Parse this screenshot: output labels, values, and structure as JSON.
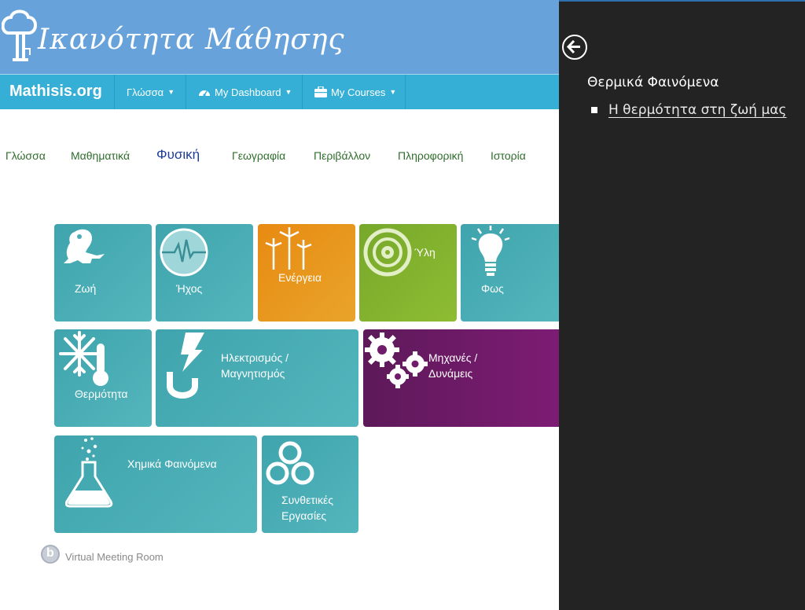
{
  "header": {
    "logo_text": "Ικανότητα Μάθησης"
  },
  "navbar": {
    "brand": "Mathisis.org",
    "language_menu": "Γλώσσα",
    "dashboard_menu": "My Dashboard",
    "courses_menu": "My Courses"
  },
  "subjects": {
    "items": [
      "Γλώσσα",
      "Μαθηματικά",
      "Φυσική",
      "Γεωγραφία",
      "Περιβάλλον",
      "Πληροφορική",
      "Ιστορία"
    ],
    "active": "Φυσική"
  },
  "tiles": {
    "life": "Ζωή",
    "sound": "Ήχος",
    "energy": "Ενέργεια",
    "matter": "Ύλη",
    "light": "Φως",
    "heat": "Θερμότητα",
    "electricity_line1": "Ηλεκτρισμός /",
    "electricity_line2": "Μαγνητισμός",
    "machines_line1": "Μηχανές /",
    "machines_line2": "Δυνάμεις",
    "chemical": "Χημικά Φαινόμενα",
    "synthetic_line1": "Συνθετικές",
    "synthetic_line2": "Εργασίες"
  },
  "footer": {
    "virtual_meeting_room": "Virtual Meeting Room",
    "icon_letter": "b"
  },
  "side_panel": {
    "title": "Θερμικά Φαινόμενα",
    "links": [
      "Η θερμότητα στη ζωή μας"
    ]
  },
  "colors": {
    "banner": "#67a2db",
    "navbar": "#35afd6",
    "teal_tile": "#4aaeb5",
    "orange_tile": "#e8951c",
    "green_tile": "#82b22e",
    "purple_tile": "#6f1b69",
    "panel": "#232323"
  }
}
